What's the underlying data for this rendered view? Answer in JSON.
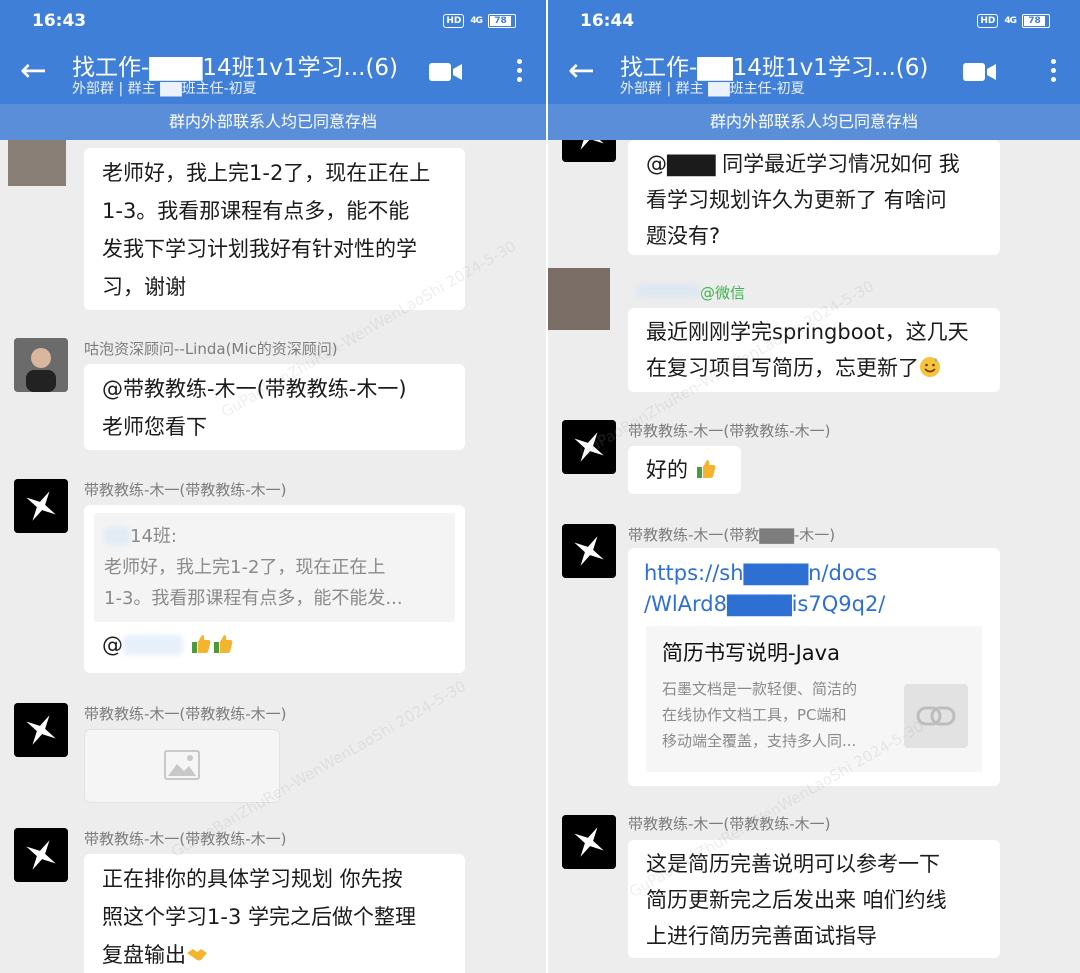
{
  "left": {
    "status": {
      "time": "16:43",
      "hd": "HD",
      "signal": "4G",
      "battery": "78"
    },
    "header": {
      "title": "找工作-▇▇▇14班1v1学习...(6)",
      "subtitle": "外部群 | 群主 ▇▇班主任-初夏"
    },
    "banner": "群内外部联系人均已同意存档",
    "messages": [
      {
        "lines": [
          "老师好，我上完1-2了，现在正在上",
          "1-3。我看那课程有点多，能不能",
          "发我下学习计划我好有针对性的学",
          "习，谢谢"
        ]
      },
      {
        "nick": "咕泡资深顾问--Linda(Mic的资深顾问)",
        "lines": [
          "@带教教练-木一(带教教练-木一)",
          "老师您看下"
        ]
      },
      {
        "nick": "带教教练-木一(带教教练-木一)",
        "quote_title": "14班:",
        "quote_lines": [
          "老师好，我上完1-2了，现在正在上",
          "1-3。我看那课程有点多，能不能发..."
        ],
        "reply_prefix": "@"
      },
      {
        "nick": "带教教练-木一(带教教练-木一)"
      },
      {
        "nick": "带教教练-木一(带教教练-木一)",
        "lines": [
          "正在排你的具体学习规划 你先按",
          "照这个学习1-3 学完之后做个整理",
          "复盘输出"
        ]
      }
    ]
  },
  "right": {
    "status": {
      "time": "16:44",
      "hd": "HD",
      "signal": "4G",
      "battery": "78"
    },
    "header": {
      "title": "找工作-▇▇14班1v1学习...(6)",
      "subtitle": "外部群 | 群主 ▇▇班主任-初夏"
    },
    "banner": "群内外部联系人均已同意存档",
    "messages": [
      {
        "lines": [
          "@▇▇▇ 同学最近学习情况如何 我",
          "看学习规划许久为更新了 有啥问",
          "题没有?"
        ]
      },
      {
        "nick_suffix": "@微信",
        "lines": [
          "最近刚刚学完springboot，这几天",
          "在复习项目写简历，忘更新了"
        ]
      },
      {
        "nick": "带教教练-木一(带教教练-木一)",
        "lines": [
          "好的"
        ]
      },
      {
        "nick": "带教教练-木一(带教▇▇▇-木一)",
        "link_lines": [
          "https://sh▇▇▇▇n/docs",
          "/WlArd8▇▇▇▇is7Q9q2/"
        ],
        "card": {
          "title": "简历书写说明-Java",
          "desc": [
            "石墨文档是一款轻便、简洁的",
            "在线协作文档工具，PC端和",
            "移动端全覆盖，支持多人同..."
          ]
        }
      },
      {
        "nick": "带教教练-木一(带教教练-木一)",
        "lines": [
          "这是简历完善说明可以参考一下",
          "简历更新完之后发出来 咱们约线",
          "上进行简历完善面试指导"
        ]
      }
    ]
  },
  "watermark": "GuPaoBanZhuRen-WenWenLaoShi 2024-5-30"
}
